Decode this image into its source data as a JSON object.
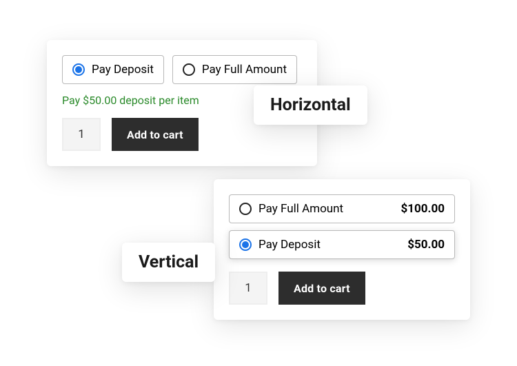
{
  "labels": {
    "horizontal": "Horizontal",
    "vertical": "Vertical"
  },
  "horizontal": {
    "options": [
      {
        "label": "Pay Deposit",
        "selected": true
      },
      {
        "label": "Pay Full Amount",
        "selected": false
      }
    ],
    "deposit_message": "Pay $50.00 deposit per item",
    "quantity": "1",
    "add_to_cart": "Add to cart"
  },
  "vertical": {
    "options": [
      {
        "label": "Pay Full Amount",
        "price": "$100.00",
        "selected": false
      },
      {
        "label": "Pay Deposit",
        "price": "$50.00",
        "selected": true
      }
    ],
    "quantity": "1",
    "add_to_cart": "Add to cart"
  }
}
